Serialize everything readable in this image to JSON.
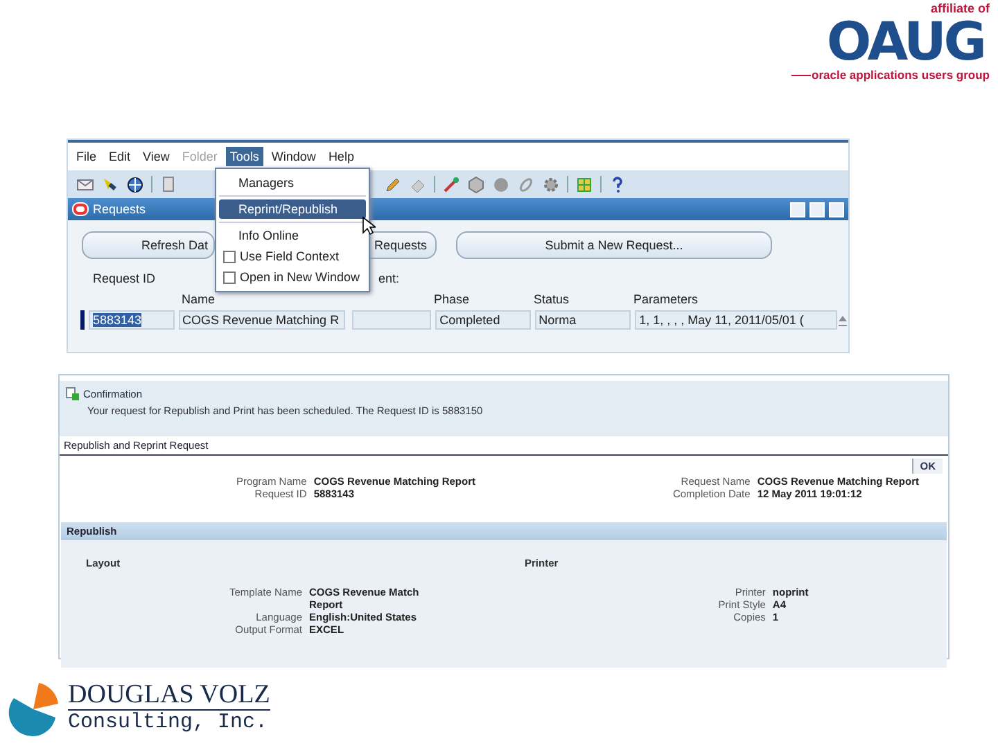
{
  "oaug_logo": {
    "affiliate": "affiliate of",
    "mark": "OAUG",
    "tagline": "oracle applications users group"
  },
  "forms_window": {
    "menu": [
      {
        "label": "File",
        "selected": false,
        "disabled": false
      },
      {
        "label": "Edit",
        "selected": false,
        "disabled": false
      },
      {
        "label": "View",
        "selected": false,
        "disabled": false
      },
      {
        "label": "Folder",
        "selected": false,
        "disabled": true
      },
      {
        "label": "Tools",
        "selected": true,
        "disabled": false
      },
      {
        "label": "Window",
        "selected": false,
        "disabled": false
      },
      {
        "label": "Help",
        "selected": false,
        "disabled": false
      }
    ],
    "tools_menu": [
      {
        "kind": "item",
        "label": "Managers",
        "selected": false
      },
      {
        "kind": "item",
        "label": "Reprint/Republish",
        "selected": true
      },
      {
        "kind": "item",
        "label": "Info Online",
        "selected": false
      },
      {
        "kind": "check",
        "label": "Use Field Context",
        "checked": false,
        "selected": false
      },
      {
        "kind": "check",
        "label": "Open in New Window",
        "checked": false,
        "selected": false
      }
    ],
    "title": "Requests",
    "buttons": [
      "Refresh Dat",
      "Requests",
      "Submit a New Request..."
    ],
    "request_id_label": "Request ID",
    "partial_label": "ent:",
    "columns": [
      {
        "label": "Name"
      },
      {
        "label": "Phase"
      },
      {
        "label": "Status"
      },
      {
        "label": "Parameters"
      }
    ],
    "row": {
      "request_id": "5883143",
      "selected": true,
      "name": "COGS Revenue Matching R",
      "phase": "Completed",
      "status": "Norma",
      "parameters": "1, 1, , , , May 11, 2011/05/01 ("
    }
  },
  "web_page": {
    "confirmation": {
      "title": "Confirmation",
      "message": "Your request for Republish and Print has been scheduled. The Request ID is 5883150"
    },
    "page_title": "Republish and Reprint Request",
    "ok_button": "OK",
    "summary_left": [
      {
        "label": "Program Name",
        "value": "COGS Revenue Matching Report"
      },
      {
        "label": "Request ID",
        "value": "5883143"
      }
    ],
    "summary_right": [
      {
        "label": "Request Name",
        "value": "COGS Revenue Matching Report"
      },
      {
        "label": "Completion Date",
        "value": "12 May 2011 19:01:12"
      }
    ],
    "section": "Republish",
    "layout": {
      "title": "Layout",
      "fields": [
        {
          "label": "Template Name",
          "value": "COGS Revenue Match Report"
        },
        {
          "label": "Language",
          "value": "English:United States"
        },
        {
          "label": "Output Format",
          "value": "EXCEL"
        }
      ]
    },
    "printer": {
      "title": "Printer",
      "fields": [
        {
          "label": "Printer",
          "value": "noprint"
        },
        {
          "label": "Print Style",
          "value": "A4"
        },
        {
          "label": "Copies",
          "value": "1"
        }
      ]
    }
  },
  "company_logo": {
    "name": "DOUGLAS VOLZ",
    "subtitle": "Consulting, Inc."
  }
}
